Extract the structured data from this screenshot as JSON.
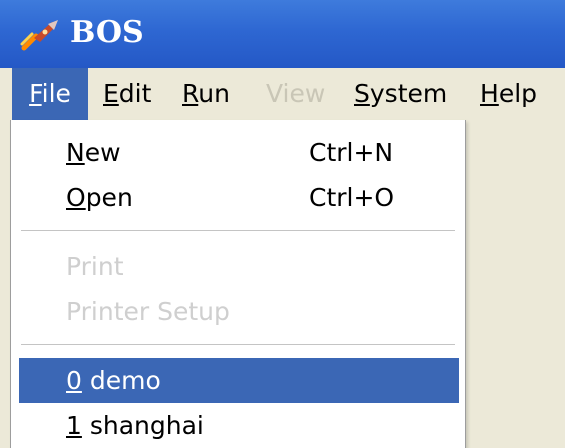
{
  "window": {
    "title": "BOS",
    "icon": "rocket-app-icon"
  },
  "menubar": {
    "items": [
      {
        "label_u": "F",
        "label_rest": "ile",
        "state": "active"
      },
      {
        "label_u": "E",
        "label_rest": "dit",
        "state": "normal"
      },
      {
        "label_u": "R",
        "label_rest": "un",
        "state": "normal"
      },
      {
        "label": "View",
        "state": "disabled"
      },
      {
        "label_u": "S",
        "label_rest": "ystem",
        "state": "normal"
      },
      {
        "label_u": "H",
        "label_rest": "elp",
        "state": "normal"
      }
    ]
  },
  "file_menu": {
    "new": {
      "label_u": "N",
      "label_rest": "ew",
      "shortcut": "Ctrl+N"
    },
    "open": {
      "label_u": "O",
      "label_rest": "pen",
      "shortcut": "Ctrl+O"
    },
    "print": {
      "label": "Print",
      "state": "disabled"
    },
    "printer_setup": {
      "label": "Printer Setup",
      "state": "disabled"
    },
    "recent": [
      {
        "label_u": "0",
        "label_rest": " demo",
        "state": "selected"
      },
      {
        "label_u": "1",
        "label_rest": " shanghai",
        "state": "normal"
      }
    ]
  },
  "colors": {
    "titlebar": "#2e67d2",
    "highlight": "#3b67b5",
    "menu_background": "#ece9d8",
    "disabled_text": "#cfcfcf"
  }
}
